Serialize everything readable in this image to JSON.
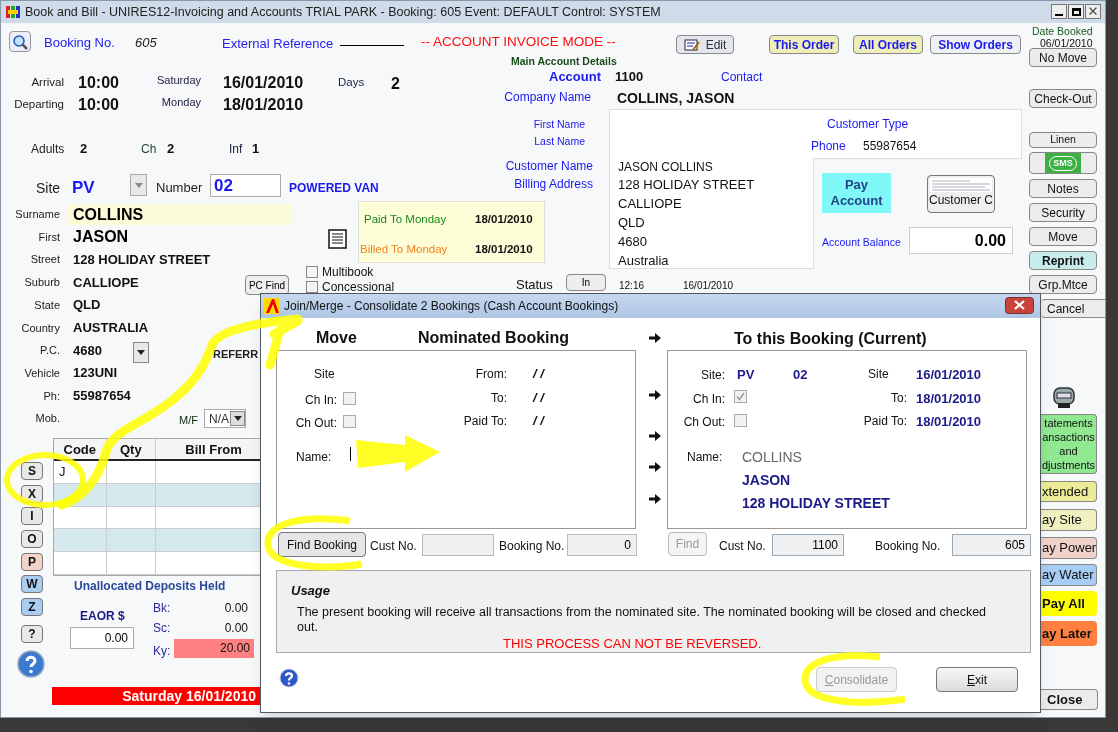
{
  "window": {
    "title": "Book and Bill - UNIRES12-Invoicing and Accounts TRIAL PARK - Booking: 605 Event: DEFAULT Control: SYSTEM"
  },
  "header": {
    "booking_no_label": "Booking No.",
    "booking_no": "605",
    "external_reference_label": "External Reference",
    "mode": "-- ACCOUNT INVOICE MODE --",
    "date_booked_label": "Date Booked",
    "date_booked": "06/01/2010"
  },
  "toolbar": [
    {
      "label": "Edit",
      "kind": "edit"
    },
    {
      "label": "This Order",
      "kind": "order"
    },
    {
      "label": "All Orders",
      "kind": "order"
    },
    {
      "label": "Show Orders",
      "kind": "plain"
    }
  ],
  "stay": {
    "arrival_label": "Arrival",
    "arrival_time": "10:00",
    "arrival_day": "Saturday",
    "arrival_date": "16/01/2010",
    "days_label": "Days",
    "days": "2",
    "departing_label": "Departing",
    "departing_time": "10:00",
    "departing_day": "Monday",
    "departing_date": "18/01/2010",
    "adults_label": "Adults",
    "adults": "2",
    "ch_label": "Ch",
    "ch": "2",
    "inf_label": "Inf",
    "inf": "1"
  },
  "site": {
    "label": "Site",
    "code": "PV",
    "number_label": "Number",
    "number": "02",
    "description": "POWERED VAN"
  },
  "guest": [
    {
      "label": "Surname",
      "value": "COLLINS",
      "kind": "highlighted"
    },
    {
      "label": "First",
      "value": "JASON",
      "kind": "large"
    },
    {
      "label": "Street",
      "value": "128 HOLIDAY STREET",
      "kind": "plain"
    },
    {
      "label": "Suburb",
      "value": "CALLIOPE",
      "kind": "plain"
    },
    {
      "label": "State",
      "value": "QLD",
      "kind": "plain"
    },
    {
      "label": "Country",
      "value": "AUSTRALIA",
      "kind": "plain"
    },
    {
      "label": "P.C.",
      "value": "4680",
      "kind": "plain"
    },
    {
      "label": "Vehicle",
      "value": "123UNI",
      "kind": "plain"
    },
    {
      "label": "Ph:",
      "value": "55987654",
      "kind": "plain"
    },
    {
      "label": "Mob."
    }
  ],
  "pc_find_button": "PC Find",
  "referral_label": "REFERR",
  "mf_label": "M/F",
  "mf_value": "N/A",
  "paid": {
    "paid_to_label": "Paid To",
    "paid_to_day": "Monday",
    "paid_to_date": "18/01/2010",
    "billed_to_label": "Billed To",
    "billed_to_day": "Monday",
    "billed_to_date": "18/01/2010"
  },
  "options": [
    {
      "label": "Multibook",
      "checked": false
    },
    {
      "label": "Concessional",
      "checked": false
    }
  ],
  "status": {
    "label": "Status",
    "button": "In",
    "time": "12:16",
    "date": "16/01/2010"
  },
  "account": {
    "section_title": "Main Account Details",
    "account_label": "Account",
    "account": "1100",
    "contact_label": "Contact",
    "company_label": "Company Name",
    "company": "COLLINS, JASON",
    "first_name_label": "First Name",
    "last_name_label": "Last Name",
    "customer_type_label": "Customer Type",
    "phone_label": "Phone",
    "phone": "55987654",
    "customer_name_label": "Customer Name",
    "billing_address_label": "Billing Address",
    "address_lines": [
      "JASON COLLINS",
      "128 HOLIDAY STREET",
      "CALLIOPE",
      "QLD",
      "4680",
      "Australia"
    ],
    "pay_button": "Pay Account",
    "customer_button": "Customer C",
    "balance_label": "Account Balance",
    "balance": "0.00"
  },
  "grid": {
    "columns": [
      "Code",
      "Qty",
      "Bill From"
    ],
    "rows": [
      [
        "J",
        "",
        ""
      ],
      [
        "",
        "",
        ""
      ],
      [
        "",
        "",
        ""
      ],
      [
        "",
        "",
        ""
      ],
      [
        "",
        "",
        ""
      ]
    ]
  },
  "side_letters": [
    {
      "label": "S",
      "color": "#e8e8e8"
    },
    {
      "label": "X",
      "color": "#e8e8e8"
    },
    {
      "label": "I",
      "color": "#e8e8e8"
    },
    {
      "label": "O",
      "color": "#e8e8e8"
    },
    {
      "label": "P",
      "color": "#f2d3c8"
    },
    {
      "label": "W",
      "color": "#a9cdf0"
    },
    {
      "label": "Z",
      "color": "#a9cdf0"
    },
    {
      "label": "?",
      "color": "#e8e8e8"
    }
  ],
  "deposits": {
    "title": "Unallocated Deposits Held",
    "eaor_label": "EAOR $",
    "eaor": "0.00",
    "bk_label": "Bk:",
    "bk": "0.00",
    "sc_label": "Sc:",
    "sc": "0.00",
    "ky_label": "Ky:",
    "ky": "20.00"
  },
  "date_bar": "Saturday 16/01/2010",
  "right_buttons": [
    {
      "label": "No Move",
      "kind": "button"
    },
    {
      "label": "Check-Out",
      "kind": "button"
    },
    {
      "label": "Linen",
      "kind": "small"
    },
    {
      "label": "SMS",
      "kind": "sms"
    },
    {
      "label": "Notes",
      "kind": "button"
    },
    {
      "label": "Security",
      "kind": "button"
    },
    {
      "label": "Move",
      "kind": "button"
    },
    {
      "label": "Reprint",
      "kind": "teal"
    },
    {
      "label": "Grp.Mtce",
      "kind": "button"
    },
    {
      "label": "Cancel",
      "kind": "button"
    }
  ],
  "lower_buttons": [
    {
      "lines": [
        "tatements",
        "ansactions",
        "and",
        "djustments"
      ],
      "color": "#90e890"
    },
    {
      "lines": [
        "xtended"
      ],
      "color": "#ecec98"
    },
    {
      "lines": [
        "ay Site"
      ],
      "color": "#f0f0c0"
    },
    {
      "lines": [
        "ay Power"
      ],
      "color": "#f0d2c8"
    },
    {
      "lines": [
        "ay Water"
      ],
      "color": "#a8cdf4"
    },
    {
      "lines": [
        "Pay All"
      ],
      "color": "#ffff00"
    },
    {
      "lines": [
        "ay Later"
      ],
      "color": "#ff8040"
    }
  ],
  "close_button": "Close",
  "dialog": {
    "title": "Join/Merge - Consolidate 2 Bookings (Cash Account Bookings)",
    "move_label": "Move",
    "nominated_title": "Nominated Booking",
    "current_title": "To this Booking (Current)",
    "left": {
      "site_label": "Site",
      "from_label": "From:",
      "from": "/ /",
      "ch_in_label": "Ch In:",
      "ch_in": false,
      "to_label": "To:",
      "to": "/ /",
      "ch_out_label": "Ch Out:",
      "ch_out": false,
      "paid_to_label": "Paid To:",
      "paid_to": "/ /",
      "name_label": "Name:",
      "find_button": "Find Booking",
      "find_disabled": false,
      "cust_no_label": "Cust No.",
      "booking_no_label": "Booking No.",
      "booking_no": "0"
    },
    "right": {
      "site_label": "Site:",
      "site": "PV",
      "site_number": "02",
      "from_label": "Site",
      "from": "16/01/2010",
      "ch_in_label": "Ch In:",
      "ch_in": true,
      "to_label": "To:",
      "to": "18/01/2010",
      "ch_out_label": "Ch Out:",
      "ch_out": false,
      "paid_to_label": "Paid To:",
      "paid_to": "18/01/2010",
      "name_label": "Name:",
      "name_lines": [
        "COLLINS",
        "JASON",
        "128 HOLIDAY STREET"
      ],
      "find_button": "Find",
      "find_disabled": true,
      "cust_no_label": "Cust No.",
      "cust_no": "1100",
      "booking_no_label": "Booking No.",
      "booking_no": "605"
    },
    "usage_title": "Usage",
    "usage_text": "The present booking will receive all transactions from the nominated site. The nominated booking will be closed and checked out.",
    "warning": "THIS PROCESS CAN NOT BE REVERSED.",
    "consolidate_button": "Consolidate",
    "consolidate_disabled": true,
    "exit_button": "Exit"
  }
}
